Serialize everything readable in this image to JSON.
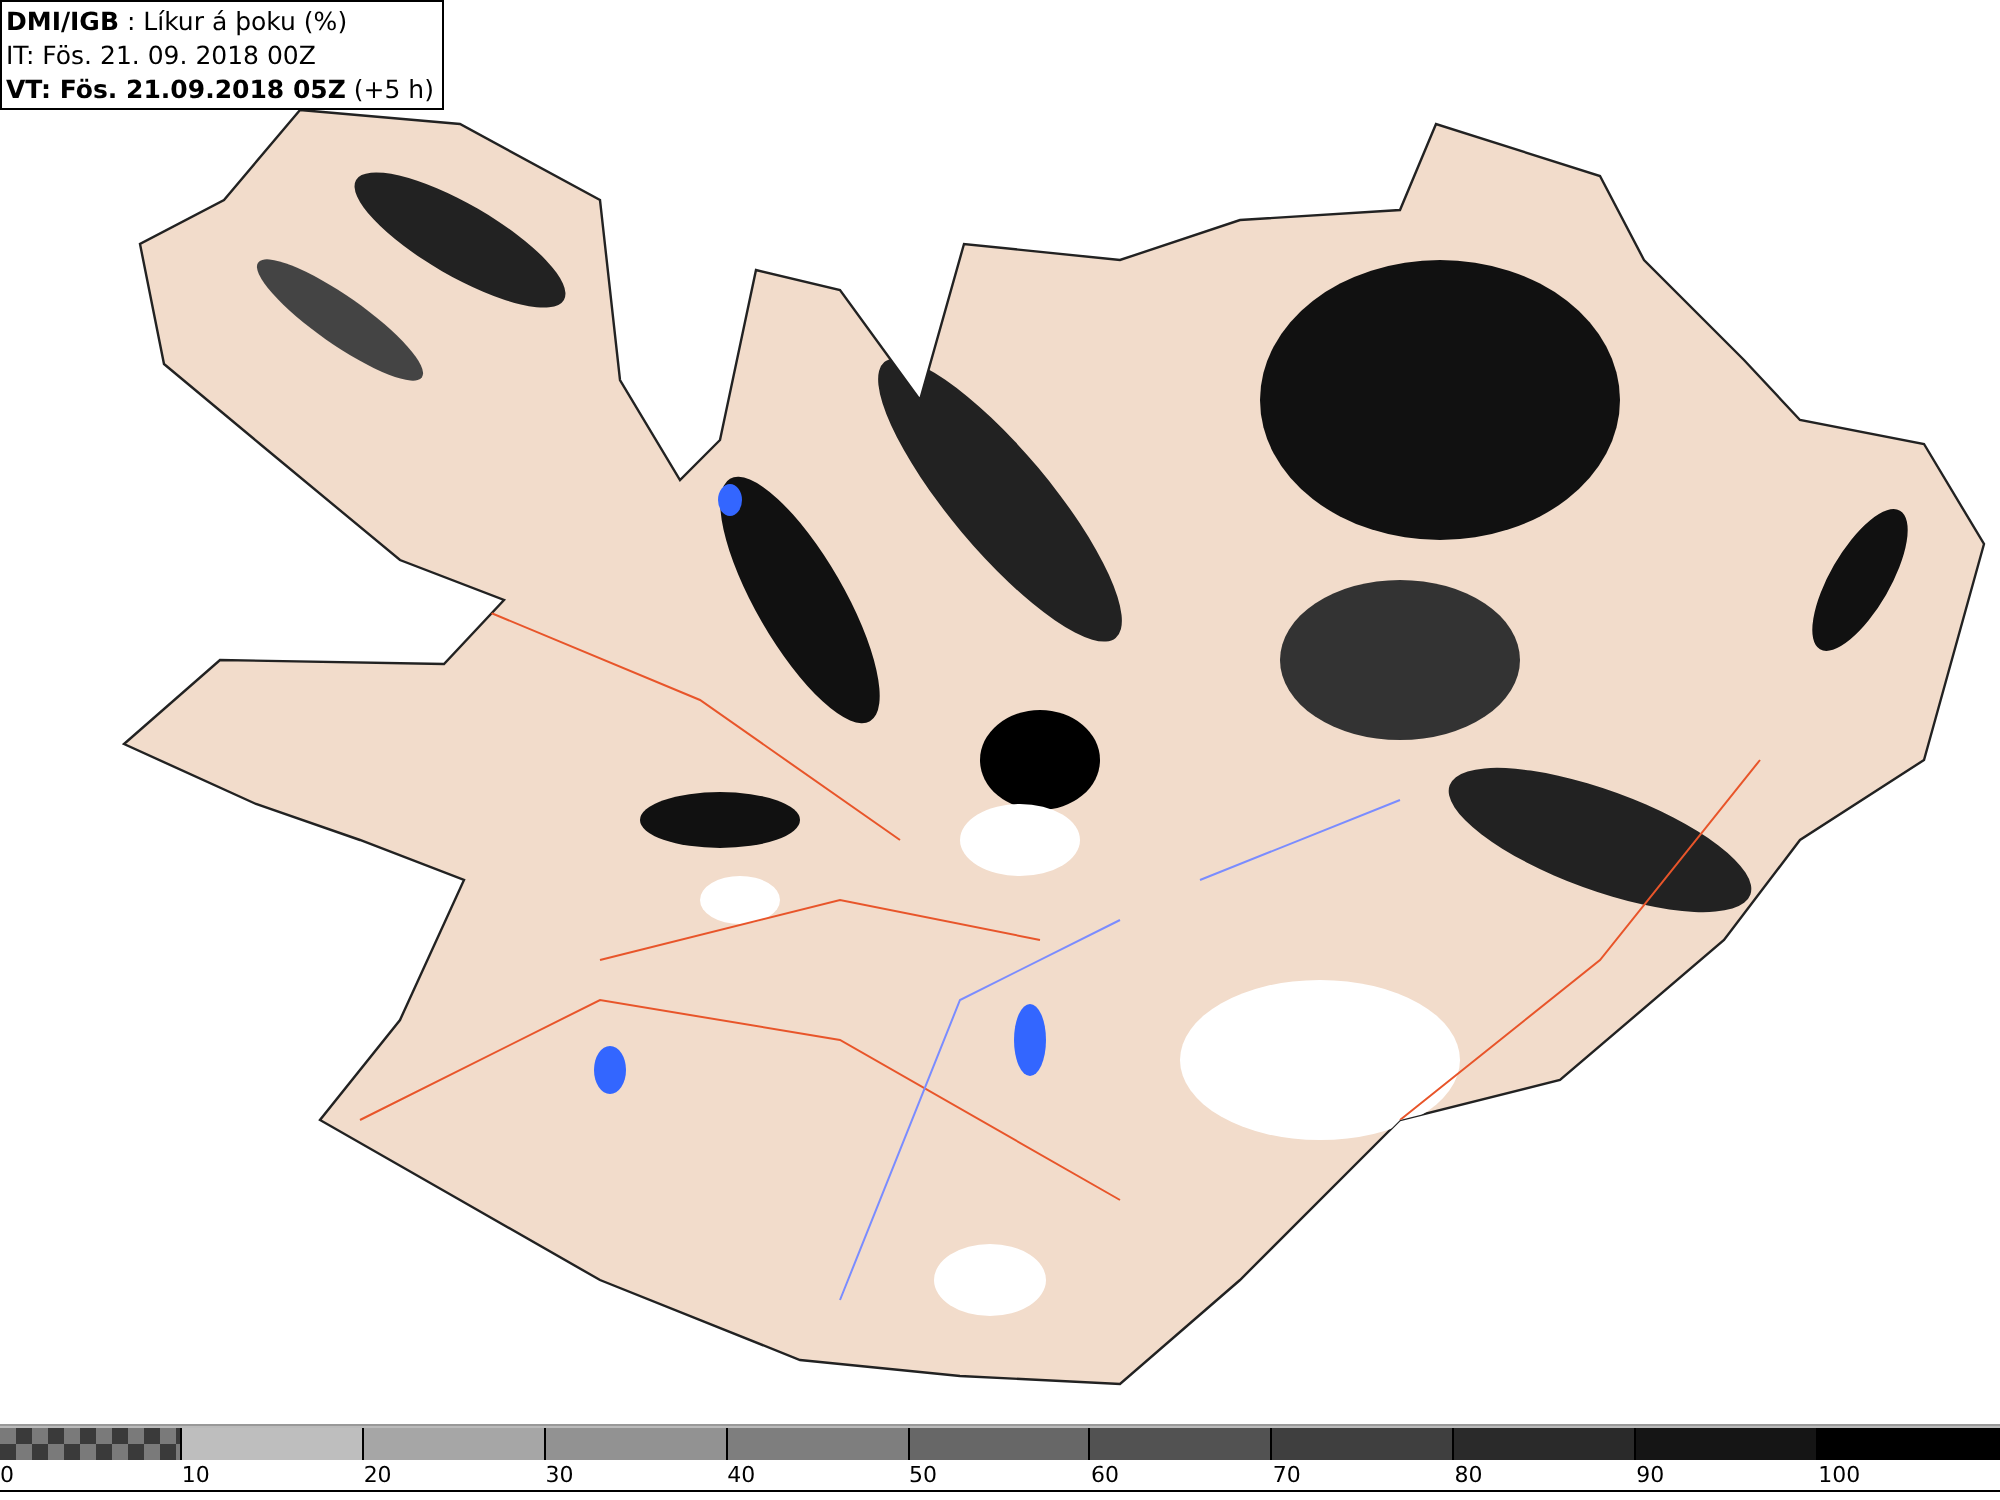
{
  "header": {
    "lines": [
      "**DMI/IGB** : Líkur á þoku (%)",
      "IT: Fös. 21. 09. 2018 00Z",
      "**VT: Fös. 21.09.2018 05Z** (+5 h)"
    ]
  },
  "legend": {
    "segments": [
      {
        "label": "0",
        "kind": "checker",
        "color": "#3a3a3a"
      },
      {
        "label": "10",
        "kind": "solid",
        "color": "#bebebe"
      },
      {
        "label": "20",
        "kind": "solid",
        "color": "#a6a6a6"
      },
      {
        "label": "30",
        "kind": "solid",
        "color": "#929292"
      },
      {
        "label": "40",
        "kind": "solid",
        "color": "#7e7e7e"
      },
      {
        "label": "50",
        "kind": "solid",
        "color": "#676767"
      },
      {
        "label": "60",
        "kind": "solid",
        "color": "#525252"
      },
      {
        "label": "70",
        "kind": "solid",
        "color": "#3f3f3f"
      },
      {
        "label": "80",
        "kind": "solid",
        "color": "#2a2a2a"
      },
      {
        "label": "90",
        "kind": "solid",
        "color": "#151515"
      },
      {
        "label": "100",
        "kind": "solid",
        "color": "#000000"
      }
    ]
  }
}
